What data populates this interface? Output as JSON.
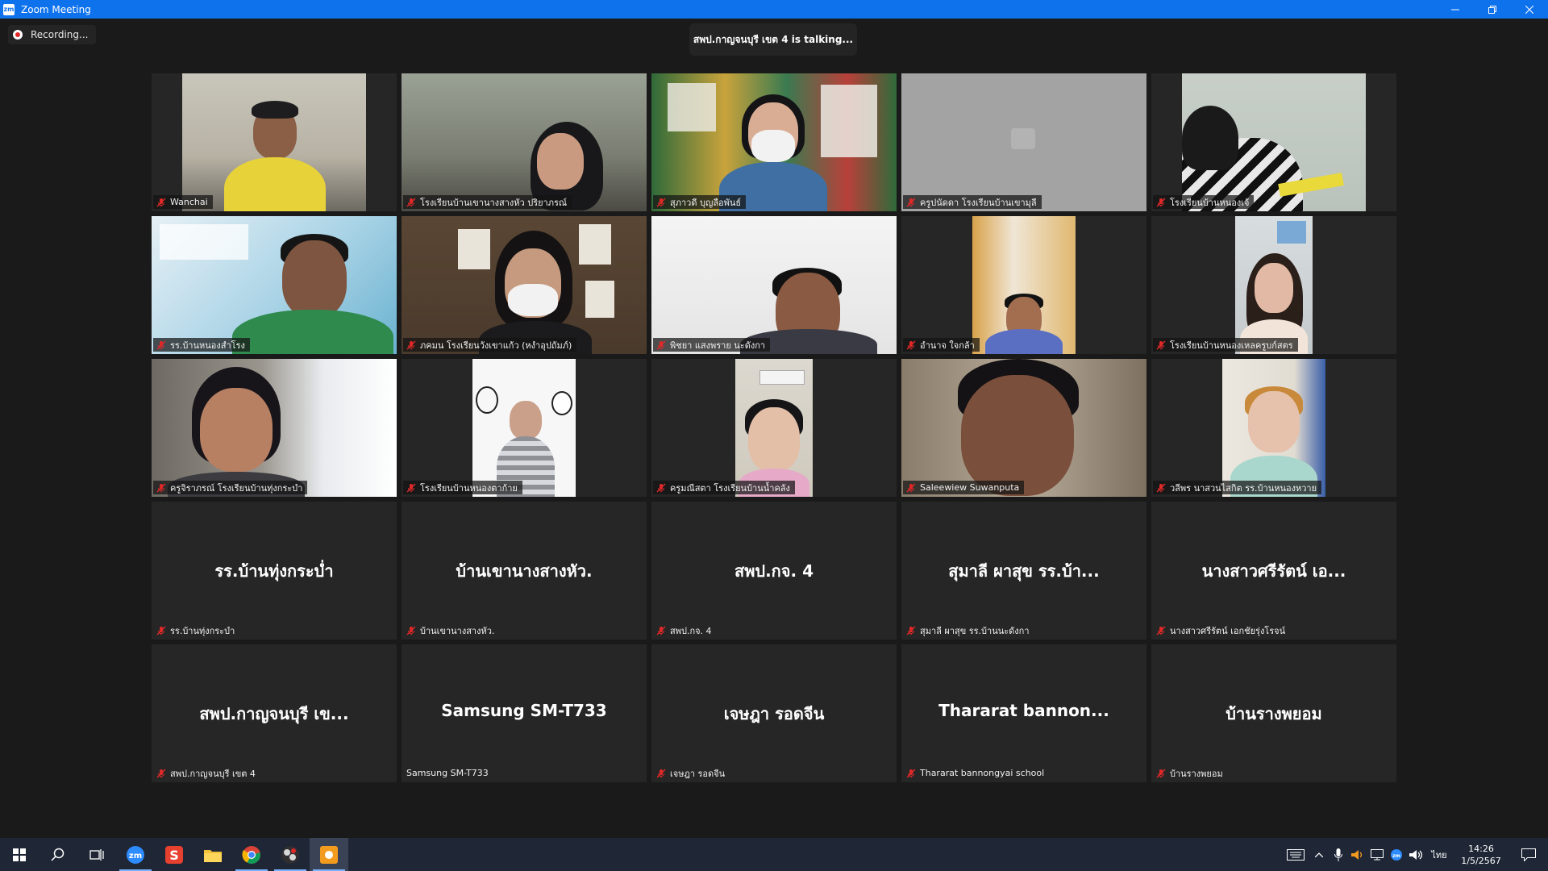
{
  "window": {
    "title": "Zoom Meeting",
    "logo": "zm",
    "controls": [
      "minimize-icon",
      "restore-icon",
      "close-icon"
    ]
  },
  "recording": {
    "label": "Recording..."
  },
  "talking": {
    "text": "สพป.กาญจนบุรี เขต 4 is  talking..."
  },
  "participants": [
    {
      "name": "Wanchai",
      "muted": true
    },
    {
      "name": "โรงเรียนบ้านเขานางสางหัว ปริยาภรณ์",
      "muted": true
    },
    {
      "name": "สุภาวดี บุญลือพันธ์",
      "muted": true
    },
    {
      "name": "ครูปนัดดา โรงเรียนบ้านเขามุลี",
      "muted": true
    },
    {
      "name": "โรงเรียนบ้านหนองเจ้",
      "muted": true
    },
    {
      "name": "รร.บ้านหนองสำโรง",
      "muted": true
    },
    {
      "name": "ภคมน โรงเรียนวังเขาแก้ว (หงำอุปถัมภ์)",
      "muted": true
    },
    {
      "name": "พิชยา แสงพราย นะดังกา",
      "muted": true
    },
    {
      "name": "อำนาจ  ใจกล้า",
      "muted": true
    },
    {
      "name": "โรงเรียนบ้านหนองเหลครูบก์สตร",
      "muted": true
    },
    {
      "name": "ครูจิราภรณ์ โรงเรียนบ้านทุ่งกระบำ",
      "muted": true
    },
    {
      "name": "โรงเรียนบ้านหนองตาก้าย",
      "muted": true
    },
    {
      "name": "ครูมณีสตา โรงเรียนบ้านน้ำคลัง",
      "muted": true
    },
    {
      "name": "Saleewiew Suwanputa",
      "muted": true
    },
    {
      "name": "วลีพร  นาสวนไสกิต รร.บ้านหนองหวาย",
      "muted": true
    },
    {
      "display": "รร.บ้านทุ่งกระบ่ำ",
      "name": "รร.บ้านทุ่งกระบำ",
      "muted": true
    },
    {
      "display": "บ้านเขานางสางหัว.",
      "name": "บ้านเขานางสางหัว.",
      "muted": true
    },
    {
      "display": "สพป.กจ. 4",
      "name": "สพป.กจ. 4",
      "muted": true
    },
    {
      "display": "สุมาลี ผาสุข รร.บ้า...",
      "name": "สุมาลี ผาสุข รร.บ้านนะดังกา",
      "muted": true
    },
    {
      "display": "นางสาวศรีรัตน์ เอ...",
      "name": "นางสาวศรีรัตน์  เอกชัยรุ่งโรจน์",
      "muted": true
    },
    {
      "display": "สพป.กาญจนบุรี เข...",
      "name": "สพป.กาญจนบุรี เขต 4",
      "muted": true
    },
    {
      "display": "Samsung SM-T733",
      "name": "Samsung SM-T733",
      "muted": false
    },
    {
      "display": "เจษฎา รอดจีน",
      "name": "เจษฎา รอดจีน",
      "muted": true
    },
    {
      "display": "Thararat bannon...",
      "name": "Thararat bannongyai school",
      "muted": true
    },
    {
      "display": "บ้านรางพยอม",
      "name": "บ้านรางพยอม",
      "muted": true
    }
  ],
  "taskbar": {
    "apps": [
      "windows-start-icon",
      "search-icon",
      "task-view-icon",
      "zoom-app-icon",
      "wps-app-icon",
      "file-explorer-icon",
      "chrome-icon",
      "obs-icon",
      "paint-app-icon"
    ],
    "tray": {
      "language": "ไทย",
      "time": "14:26",
      "date": "1/5/2567"
    }
  },
  "colors": {
    "titlebar": "#0e72ed",
    "stage": "#1a1a1a",
    "tile": "#262626",
    "muted": "#e02828",
    "taskbar": "#1f2736"
  }
}
